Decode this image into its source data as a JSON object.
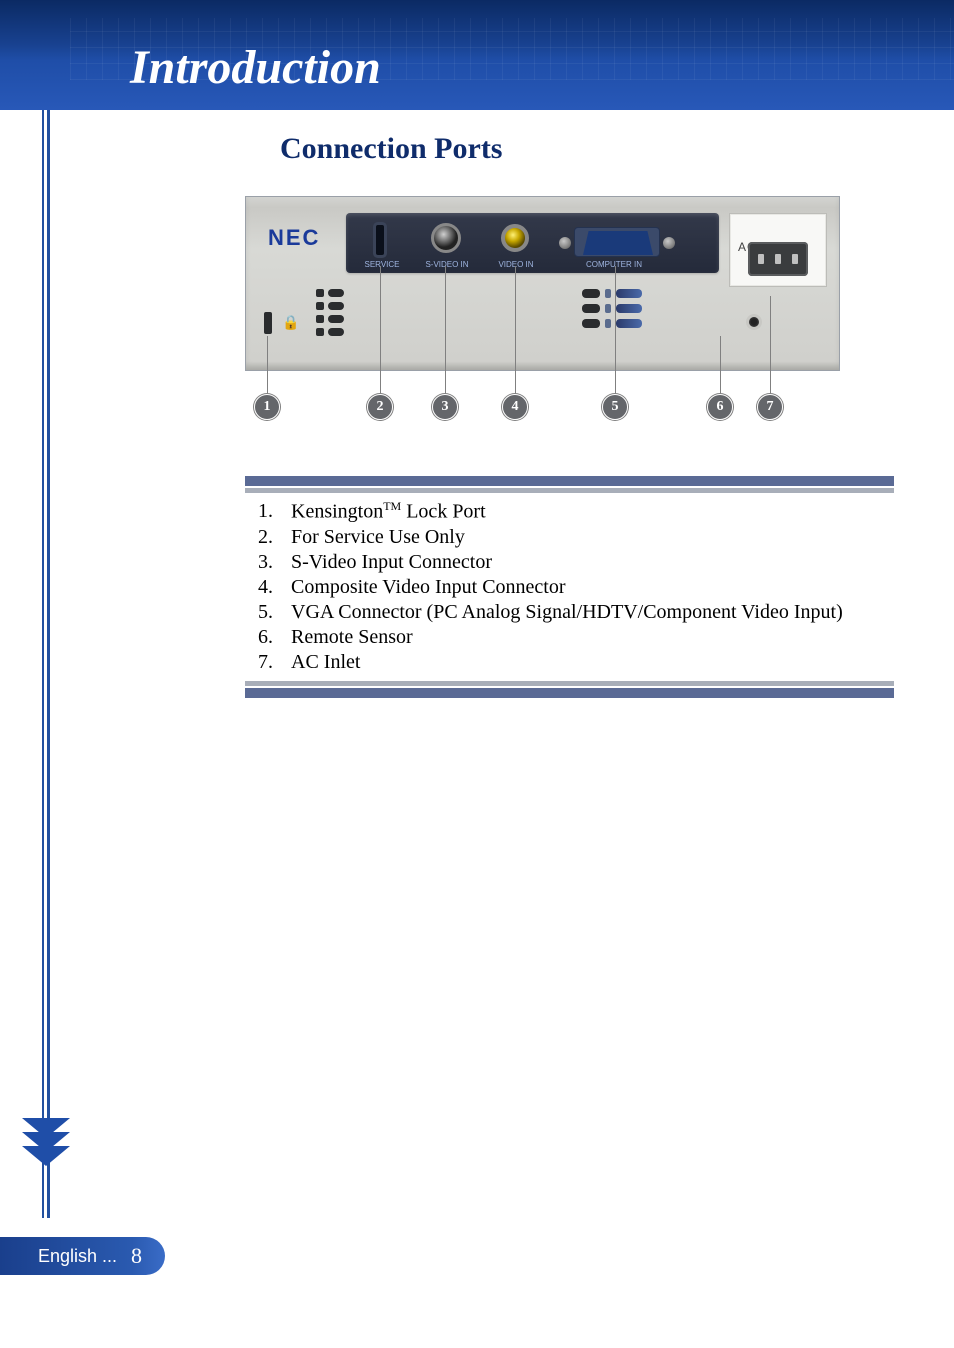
{
  "header": {
    "title": "Introduction"
  },
  "section": {
    "heading": "Connection Ports"
  },
  "device": {
    "brand": "NEC",
    "ac_label": "AC IN ∼",
    "panel_labels": {
      "service": "SERVICE",
      "svideo": "S-VIDEO IN",
      "video": "VIDEO IN",
      "computer": "COMPUTER IN"
    }
  },
  "callouts": [
    "1",
    "2",
    "3",
    "4",
    "5",
    "6",
    "7"
  ],
  "ports": [
    {
      "num": "1.",
      "label_pre": "Kensington",
      "tm": "TM",
      "label_post": " Lock Port"
    },
    {
      "num": "2.",
      "label": "For Service Use Only"
    },
    {
      "num": "3.",
      "label": "S-Video Input Connector"
    },
    {
      "num": "4.",
      "label": "Composite Video Input Connector"
    },
    {
      "num": "5.",
      "label": "VGA Connector (PC Analog Signal/HDTV/Component Video Input)"
    },
    {
      "num": "6.",
      "label": "Remote Sensor"
    },
    {
      "num": "7.",
      "label": "AC Inlet"
    }
  ],
  "footer": {
    "language": "English ...",
    "page": "8"
  }
}
